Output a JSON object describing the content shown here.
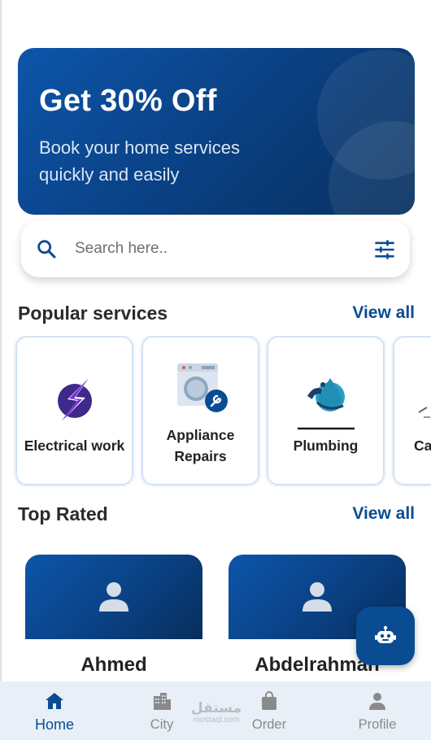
{
  "banner": {
    "title": "Get 30% Off",
    "subtitle": "Book your home services quickly and easily"
  },
  "search": {
    "placeholder": "Search here..",
    "value": ""
  },
  "popular": {
    "title": "Popular services",
    "view_all": "View all",
    "items": [
      {
        "label": "Electrical work",
        "icon": "lightning-bolt-icon"
      },
      {
        "label": "Appliance Repairs",
        "icon": "washing-machine-wrench-icon"
      },
      {
        "label": "Plumbing",
        "icon": "water-drop-pipe-icon"
      },
      {
        "label": "Ca",
        "icon": "partial-icon"
      }
    ]
  },
  "top_rated": {
    "title": "Top Rated",
    "view_all": "View all",
    "pros": [
      {
        "name": "Ahmed",
        "icon": "person-icon"
      },
      {
        "name": "Abdelrahman",
        "icon": "person-icon"
      }
    ]
  },
  "fab": {
    "icon": "robot-icon"
  },
  "nav": {
    "items": [
      {
        "label": "Home",
        "icon": "home-icon",
        "active": true
      },
      {
        "label": "City",
        "icon": "city-icon",
        "active": false
      },
      {
        "label": "Order",
        "icon": "shopping-bag-icon",
        "active": false
      },
      {
        "label": "Profile",
        "icon": "person-icon",
        "active": false
      }
    ]
  },
  "watermark": {
    "arabic": "مستقل",
    "latin": "mostaql.com"
  },
  "colors": {
    "primary": "#0a4c92",
    "banner_start": "#0d55aa",
    "banner_end": "#08305f",
    "nav_bg": "#e9eff7",
    "inactive": "#8a8a8a"
  }
}
